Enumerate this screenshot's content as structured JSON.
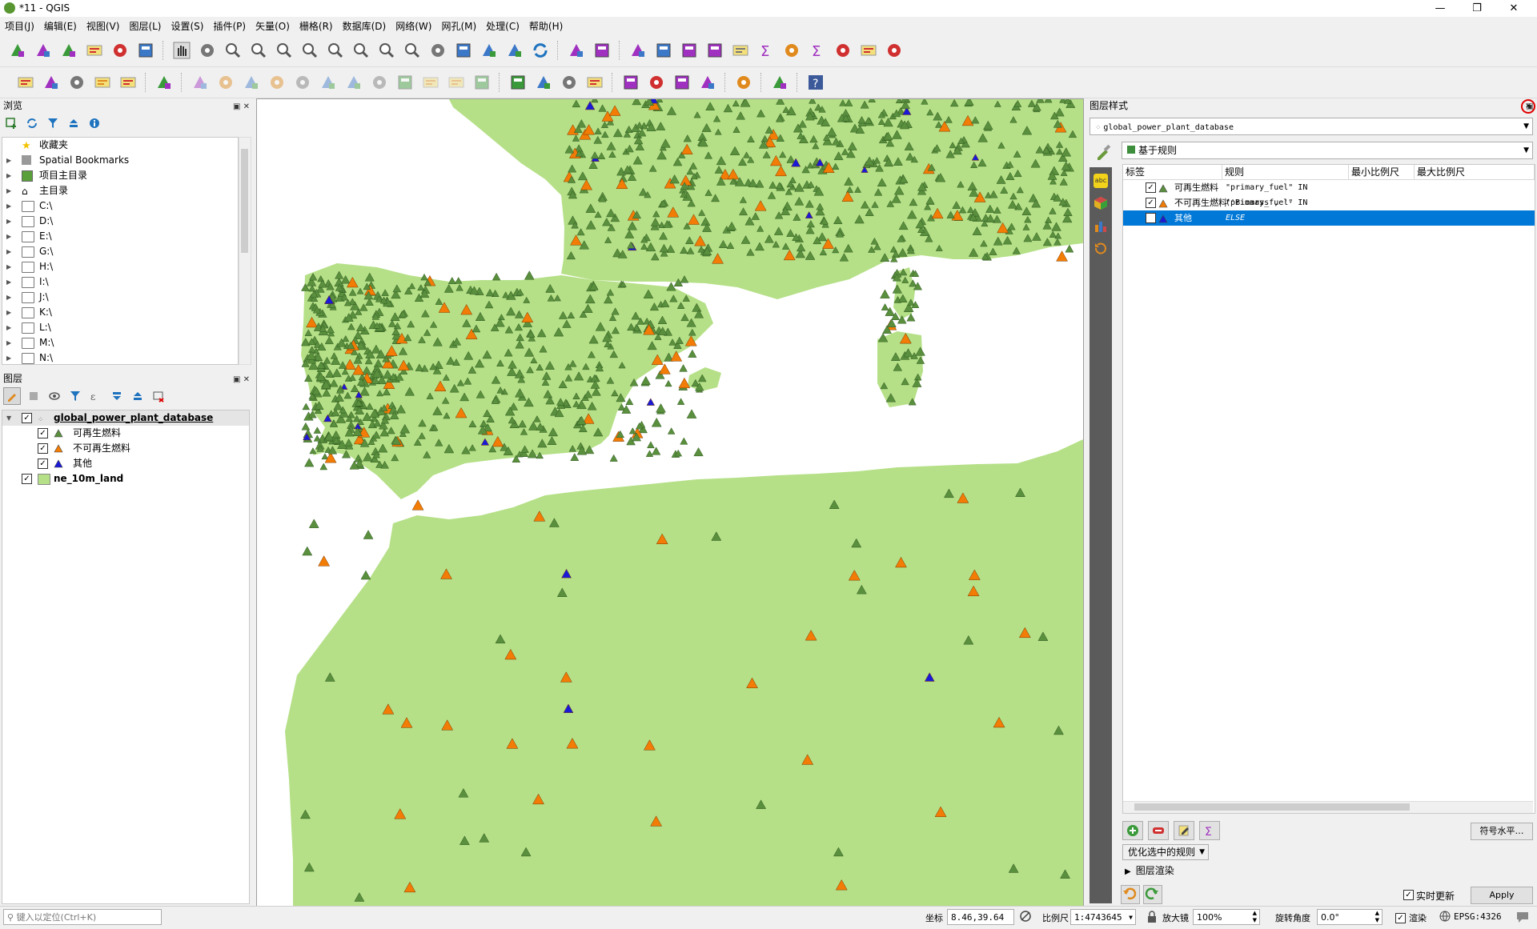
{
  "window": {
    "title": "*11 - QGIS",
    "minimize": "—",
    "restore": "❐",
    "close": "✕"
  },
  "menubar": [
    "项目(J)",
    "编辑(E)",
    "视图(V)",
    "图层(L)",
    "设置(S)",
    "插件(P)",
    "矢量(O)",
    "栅格(R)",
    "数据库(D)",
    "网络(W)",
    "网孔(M)",
    "处理(C)",
    "帮助(H)"
  ],
  "toolbar1": [
    "new-project-icon",
    "open-project-icon",
    "save-project-icon",
    "save-as-icon",
    "print-layout-icon",
    "style-manager-icon",
    "|",
    "pan-icon",
    "pan-to-selection-icon",
    "zoom-in-icon",
    "zoom-out-icon",
    "zoom-full-icon",
    "zoom-to-selection-icon",
    "zoom-to-layer-icon",
    "zoom-native-icon",
    "zoom-last-icon",
    "zoom-next-icon",
    "new-map-view-icon",
    "temporal-controller-icon",
    "new-bookmark-icon",
    "show-bookmarks-icon",
    "refresh-icon",
    "|",
    "identify-icon",
    "action-icon",
    "|",
    "select-features-icon",
    "select-value-icon",
    "deselect-icon",
    "attribute-table-icon",
    "statistics-icon",
    "field-calculator-icon",
    "toolbox-icon",
    "sum-icon",
    "measure-icon",
    "map-tips-icon",
    "text-annotation-icon"
  ],
  "toolbar2": [
    "data-source-manager-icon",
    "new-geopackage-icon",
    "new-shapefile-icon",
    "new-spatialite-icon",
    "new-virtual-layer-icon",
    "|",
    "vector-check-icon",
    "|",
    "current-edits-icon",
    "toggle-editing-icon",
    "save-edits-icon",
    "add-feature-icon",
    "vertex-tool-icon",
    "modify-attributes-icon",
    "delete-icon",
    "cut-icon",
    "copy-icon",
    "paste-icon",
    "undo-icon",
    "redo-icon",
    "|",
    "label-icon",
    "diagram-icon",
    "pin-label-icon",
    "highlight-label-icon",
    "|",
    "move-label-icon",
    "rotate-label-icon",
    "change-label-icon",
    "show-hide-label-icon",
    "|",
    "globe-icon",
    "|",
    "python-icon",
    "|",
    "help-icon"
  ],
  "browser": {
    "title": "浏览",
    "items": [
      {
        "label": "收藏夹",
        "icon": "star-icon"
      },
      {
        "label": "Spatial Bookmarks",
        "icon": "bookmark-icon"
      },
      {
        "label": "项目主目录",
        "icon": "project-home-icon"
      },
      {
        "label": "主目录",
        "icon": "home-icon"
      },
      {
        "label": "C:\\",
        "icon": "folder-icon"
      },
      {
        "label": "D:\\",
        "icon": "folder-icon"
      },
      {
        "label": "E:\\",
        "icon": "folder-icon"
      },
      {
        "label": "G:\\",
        "icon": "folder-icon"
      },
      {
        "label": "H:\\",
        "icon": "folder-icon"
      },
      {
        "label": "I:\\",
        "icon": "folder-icon"
      },
      {
        "label": "J:\\",
        "icon": "folder-icon"
      },
      {
        "label": "K:\\",
        "icon": "folder-icon"
      },
      {
        "label": "L:\\",
        "icon": "folder-icon"
      },
      {
        "label": "M:\\",
        "icon": "folder-icon"
      },
      {
        "label": "N:\\",
        "icon": "folder-icon"
      }
    ]
  },
  "layers": {
    "title": "图层",
    "layer1": {
      "name": "global_power_plant_database",
      "checked": true
    },
    "rules": [
      {
        "label": "可再生燃料",
        "color": "#5a8f3e"
      },
      {
        "label": "不可再生燃料",
        "color": "#f27c05"
      },
      {
        "label": "其他",
        "color": "#1a1ad6"
      }
    ],
    "layer2": {
      "name": "ne_10m_land",
      "color": "#b5e087"
    }
  },
  "style_panel": {
    "title": "图层样式",
    "layer_combo": "global_power_plant_database",
    "renderer_combo": "基于规则",
    "headers": [
      "标签",
      "规则",
      "最小比例尺",
      "最大比例尺"
    ],
    "rows": [
      {
        "label": "可再生燃料",
        "rule": "\"primary_fuel\" IN ('Biomass', '·",
        "color": "#5a8f3e"
      },
      {
        "label": "不可再生燃料",
        "rule": "\"primary_fuel\" IN ('Coal', 'Gas'",
        "color": "#f27c05"
      },
      {
        "label": "其他",
        "rule": "ELSE",
        "color": "#1a1ad6"
      }
    ],
    "symbol_levels_button": "符号水平…",
    "refine_combo": "优化选中的规则",
    "layer_rendering": "图层渲染",
    "live_update": "实时更新",
    "apply": "Apply"
  },
  "statusbar": {
    "locator_placeholder": "键入以定位(Ctrl+K)",
    "coord_label": "坐标",
    "coord_value": "8.46,39.64",
    "scale_label": "比例尺",
    "scale_value": "1:4743645",
    "magnifier_label": "放大镜",
    "magnifier_value": "100%",
    "rotation_label": "旋转角度",
    "rotation_value": "0.0°",
    "render_label": "渲染",
    "crs": "EPSG:4326"
  },
  "colors": {
    "land": "#b5e087",
    "renewable": "#5a8f3e",
    "nonrenewable": "#f27c05",
    "other": "#1a1ad6",
    "selection": "#0078d7"
  }
}
